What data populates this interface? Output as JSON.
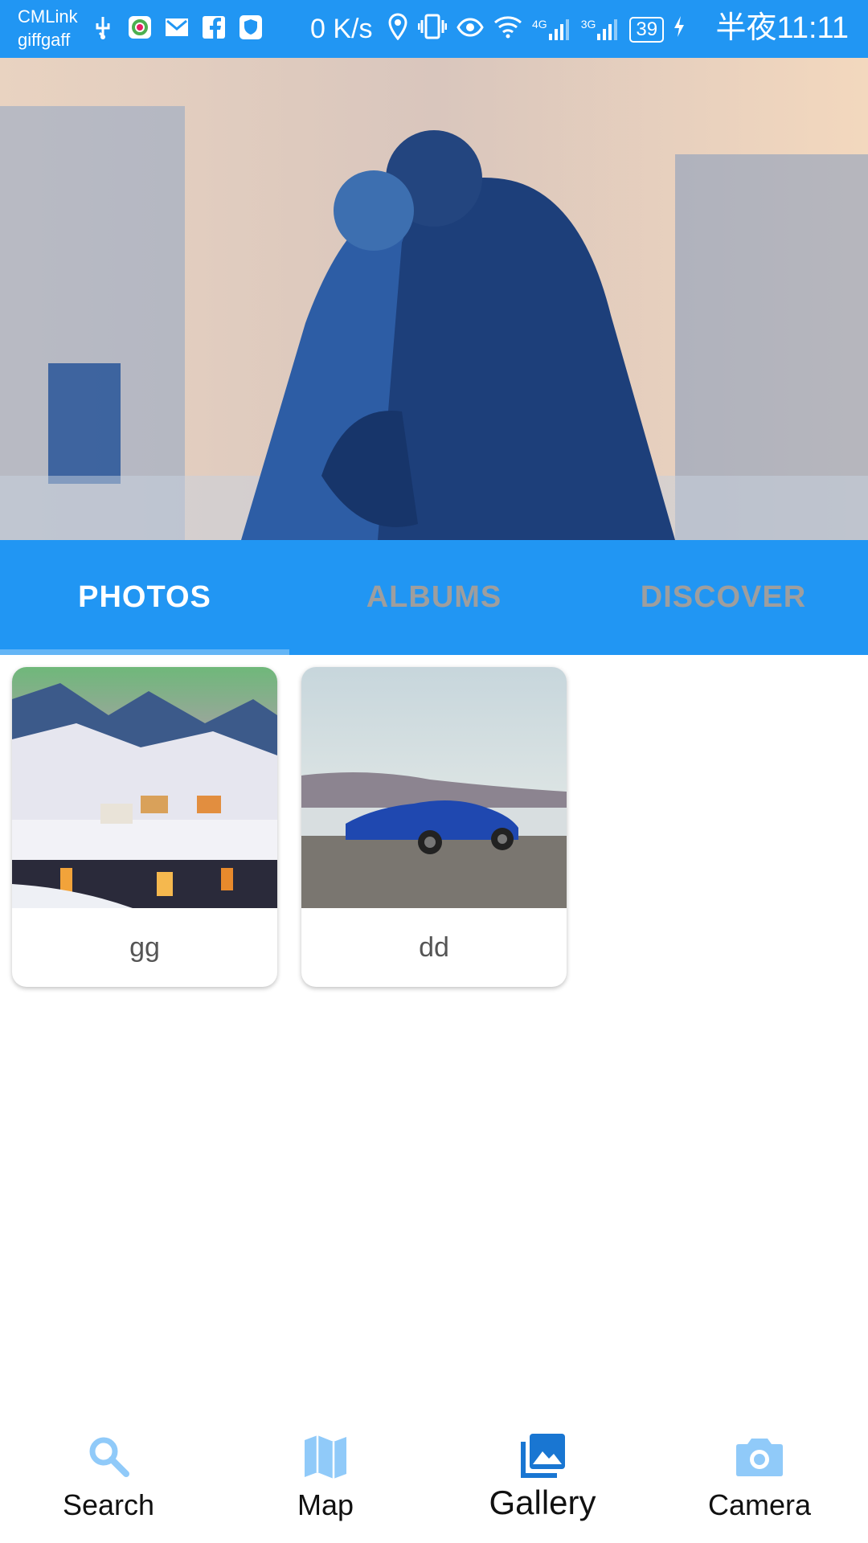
{
  "status_bar": {
    "carrier_1": "CMLink",
    "carrier_2": "giffgaff",
    "net_speed": "0 K/s",
    "net_4g": "4G",
    "net_3g": "3G",
    "battery": "39",
    "time": "半夜11:11",
    "icons": [
      "usb-icon",
      "app-icon",
      "mail-icon",
      "facebook-icon",
      "shield-icon",
      "location-icon",
      "vibrate-icon",
      "eye-icon",
      "wifi-icon",
      "signal-icon",
      "signal-icon",
      "charging-icon"
    ]
  },
  "tabs": [
    {
      "label": "PHOTOS",
      "active": true
    },
    {
      "label": "ALBUMS",
      "active": false
    },
    {
      "label": "DISCOVER",
      "active": false
    }
  ],
  "photos": [
    {
      "name": "gg"
    },
    {
      "name": "dd"
    }
  ],
  "bottom_nav": [
    {
      "label": "Search",
      "icon": "search-icon",
      "active": false
    },
    {
      "label": "Map",
      "icon": "map-icon",
      "active": false
    },
    {
      "label": "Gallery",
      "icon": "gallery-icon",
      "active": true
    },
    {
      "label": "Camera",
      "icon": "camera-icon",
      "active": false
    }
  ],
  "colors": {
    "primary": "#2196F3",
    "tab_indicator": "#64B5F6",
    "inactive_tab_text": "#9E9E9E",
    "nav_icon_inactive": "#90CAF9",
    "nav_icon_active": "#1976D2"
  }
}
